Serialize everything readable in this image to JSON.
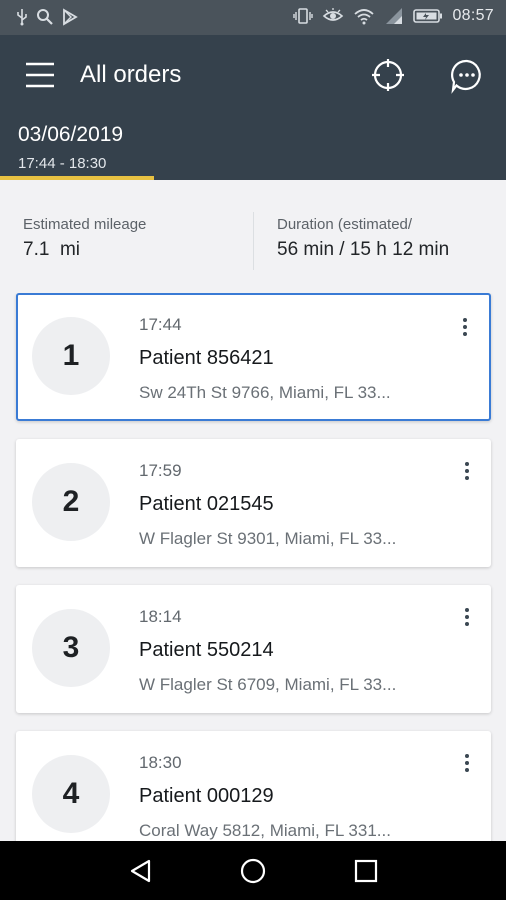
{
  "status_bar": {
    "time": "08:57",
    "left_icons": [
      "usb-icon",
      "search-icon",
      "play-store-icon"
    ],
    "right_icons": [
      "vibrate-icon",
      "eye-comfort-icon",
      "wifi-icon",
      "signal-icon",
      "battery-icon"
    ]
  },
  "app_bar": {
    "title": "All orders",
    "date": "03/06/2019",
    "time_range": "17:44 - 18:30",
    "background": "#35414c",
    "progress_color": "#e8c142",
    "progress_fraction": 0.305,
    "icons": [
      "menu-icon",
      "crosshair-icon",
      "chat-icon"
    ]
  },
  "summary": {
    "mileage_label": "Estimated mileage",
    "mileage_value": "7.1  mi",
    "duration_label": "Duration (estimated/",
    "duration_value": "56 min / 15 h 12 min"
  },
  "orders": [
    {
      "number": "1",
      "time": "17:44",
      "name": "Patient 856421",
      "address": "Sw 24Th St 9766, Miami, FL 33...",
      "selected": true
    },
    {
      "number": "2",
      "time": "17:59",
      "name": "Patient 021545",
      "address": "W Flagler St 9301, Miami, FL 33...",
      "selected": false
    },
    {
      "number": "3",
      "time": "18:14",
      "name": "Patient 550214",
      "address": "W Flagler St 6709, Miami, FL 33...",
      "selected": false
    },
    {
      "number": "4",
      "time": "18:30",
      "name": "Patient 000129",
      "address": "Coral Way 5812, Miami, FL 331...",
      "selected": false
    }
  ],
  "colors": {
    "selected_border": "#3a7bd5",
    "list_background": "#f2f2f4"
  }
}
